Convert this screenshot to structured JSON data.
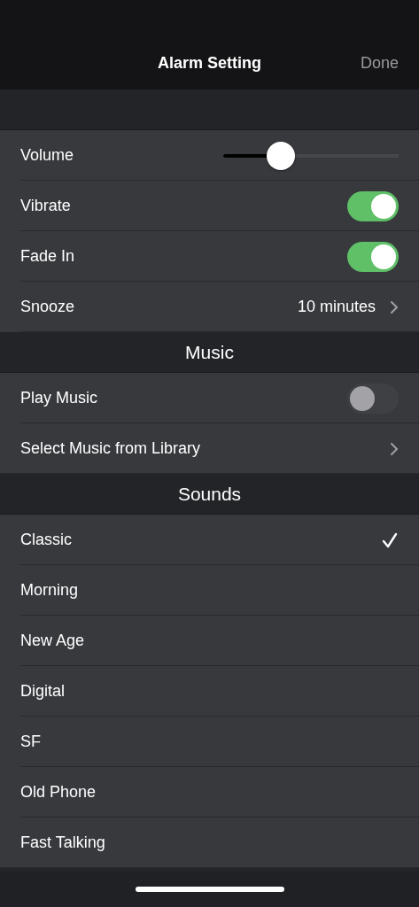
{
  "nav_bar": {
    "title": "Alarm Setting",
    "done": "Done"
  },
  "settings": [
    {
      "kind": "slider",
      "label": "Volume",
      "level": 0.33
    },
    {
      "kind": "toggle",
      "label": "Vibrate",
      "on": true
    },
    {
      "kind": "toggle",
      "label": "Fade In",
      "on": true
    },
    {
      "kind": "value",
      "label": "Snooze",
      "value": "10 minutes"
    }
  ],
  "music": {
    "header": "Music",
    "items": [
      {
        "kind": "toggle",
        "label": "Play Music",
        "on": false
      },
      {
        "kind": "link",
        "label": "Select Music from Library"
      }
    ]
  },
  "sounds": {
    "header": "Sounds",
    "items": [
      {
        "label": "Classic",
        "selected": true
      },
      {
        "label": "Morning",
        "selected": false
      },
      {
        "label": "New Age",
        "selected": false
      },
      {
        "label": "Digital",
        "selected": false
      },
      {
        "label": "SF",
        "selected": false
      },
      {
        "label": "Old Phone",
        "selected": false
      },
      {
        "label": "Fast Talking",
        "selected": false
      }
    ]
  }
}
